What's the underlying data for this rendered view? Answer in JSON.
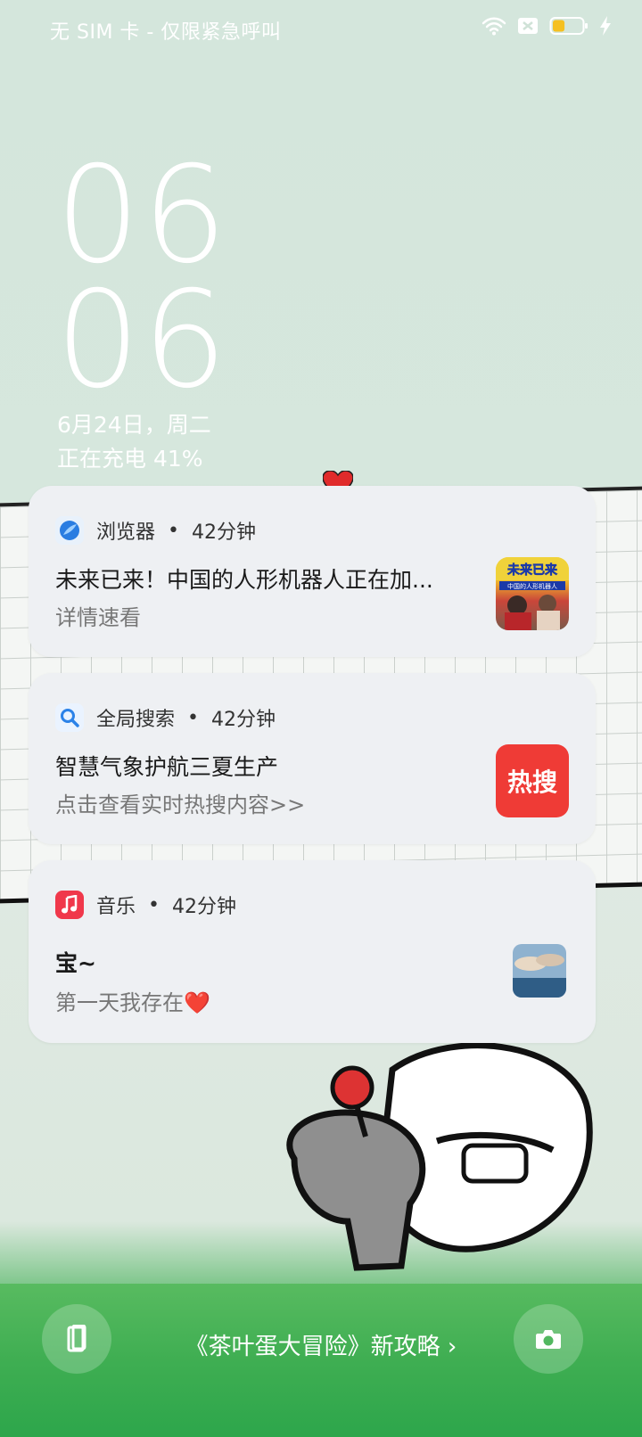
{
  "status_bar": {
    "carrier": "无 SIM 卡 - 仅限紧急呼叫",
    "icons": [
      "wifi-icon",
      "no-sim-icon",
      "battery-icon",
      "charging-bolt-icon"
    ],
    "battery_percent": 41
  },
  "clock": {
    "hour": "06",
    "minute": "06"
  },
  "date": {
    "line1": "6月24日，周二",
    "line2": "正在充电 41%"
  },
  "notifications": [
    {
      "app": "浏览器",
      "time": "42分钟",
      "icon": "browser-icon",
      "title": "未来已来！中国的人形机器人正在加...",
      "subtitle": "详情速看",
      "thumb_text": "未来已来",
      "thumb_caption": "中国的人形机器人"
    },
    {
      "app": "全局搜索",
      "time": "42分钟",
      "icon": "search-icon",
      "title": "智慧气象护航三夏生产",
      "subtitle": "点击查看实时热搜内容>>",
      "badge": "热搜"
    },
    {
      "app": "音乐",
      "time": "42分钟",
      "icon": "music-icon",
      "title": "宝~",
      "subtitle": "第一天我存在❤️"
    }
  ],
  "bottom": {
    "promo": "《茶叶蛋大冒险》新攻略 ›",
    "left_icon": "wallet-card-icon",
    "right_icon": "camera-icon"
  },
  "colors": {
    "accent_red": "#ef3b36",
    "browser_blue": "#2a7de1",
    "music_red": "#f0384b",
    "grass": "#3fae52"
  }
}
